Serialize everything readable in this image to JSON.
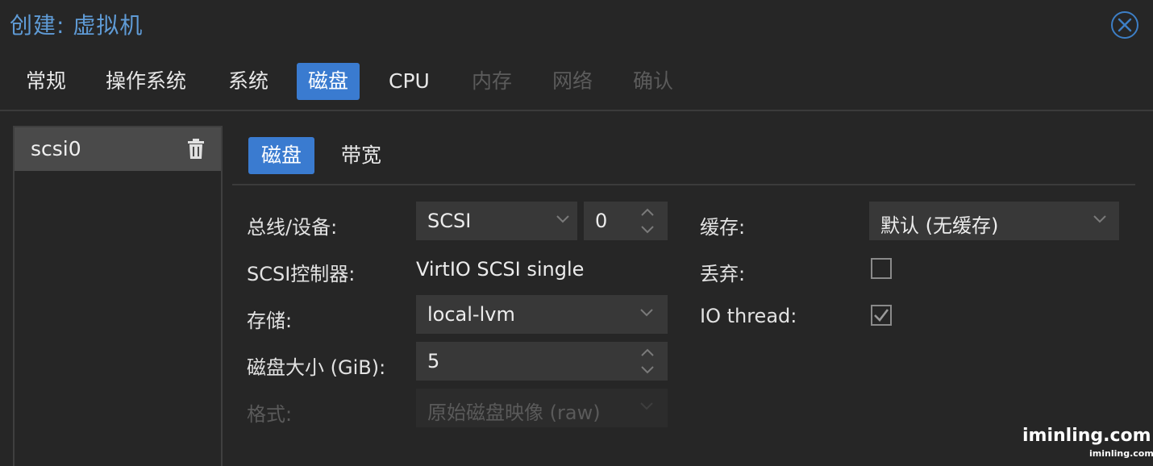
{
  "window": {
    "title": "创建: 虚拟机",
    "close_icon": "close-circle-icon"
  },
  "tabs": [
    {
      "label": "常规",
      "state": "normal"
    },
    {
      "label": "操作系统",
      "state": "normal"
    },
    {
      "label": "系统",
      "state": "normal"
    },
    {
      "label": "磁盘",
      "state": "active"
    },
    {
      "label": "CPU",
      "state": "normal"
    },
    {
      "label": "内存",
      "state": "disabled"
    },
    {
      "label": "网络",
      "state": "disabled"
    },
    {
      "label": "确认",
      "state": "disabled"
    }
  ],
  "disk_list": {
    "items": [
      {
        "label": "scsi0",
        "icon": "trash-icon"
      }
    ]
  },
  "subtabs": [
    {
      "label": "磁盘",
      "state": "active"
    },
    {
      "label": "带宽",
      "state": "normal"
    }
  ],
  "form": {
    "bus_device": {
      "label": "总线/设备:",
      "bus_value": "SCSI",
      "device_value": "0"
    },
    "scsi_controller": {
      "label": "SCSI控制器:",
      "value": "VirtIO SCSI single"
    },
    "storage": {
      "label": "存储:",
      "value": "local-lvm"
    },
    "disk_size": {
      "label": "磁盘大小 (GiB):",
      "value": "5"
    },
    "format": {
      "label": "格式:",
      "value": "原始磁盘映像 (raw)",
      "disabled": true
    },
    "cache": {
      "label": "缓存:",
      "value": "默认 (无缓存)"
    },
    "discard": {
      "label": "丢弃:",
      "checked": false
    },
    "io_thread": {
      "label": "IO thread:",
      "checked": true
    }
  },
  "watermark": {
    "main": "iminling.com",
    "small": "iminling.com"
  },
  "colors": {
    "accent": "#3a7bd0",
    "title": "#5f9bd6",
    "background": "#262626",
    "field": "#383838"
  }
}
